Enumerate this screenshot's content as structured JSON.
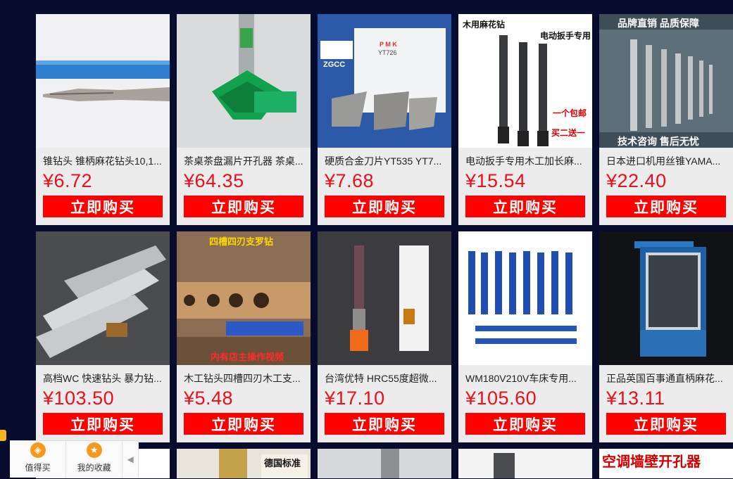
{
  "buy_label": "立即购买",
  "products": [
    {
      "title": "锥钻头 锥柄麻花钻头10,1...",
      "price": "¥6.72"
    },
    {
      "title": "茶桌茶盘漏片开孔器 茶桌...",
      "price": "¥64.35"
    },
    {
      "title": "硬质合金刀片YT535 YT7...",
      "price": "¥7.68"
    },
    {
      "title": "电动扳手专用木工加长麻...",
      "price": "¥15.54"
    },
    {
      "title": "日本进口机用丝锥YAMA...",
      "price": "¥22.40"
    },
    {
      "title": "高档WC 快速钻头 暴力钻...",
      "price": "¥103.50"
    },
    {
      "title": "木工钻头四槽四刃木工支...",
      "price": "¥5.48"
    },
    {
      "title": "台湾优特 HRC55度超微...",
      "price": "¥17.10"
    },
    {
      "title": "WM180V210V车床专用...",
      "price": "¥105.60"
    },
    {
      "title": "正品英国百事通直柄麻花...",
      "price": "¥13.11"
    }
  ],
  "image_text": {
    "p2_brand": "ZGCC",
    "p2_label_line1": "P  M  K",
    "p2_label_line2": "YT726",
    "p3_top_left": "木用麻花钻",
    "p3_top_right": "电动扳手专用",
    "p3_promo1": "一个包邮",
    "p3_promo2": "买二送一",
    "p4_top": "品牌直销 品质保障",
    "p4_bottom": "技术咨询 售后无忧",
    "p6_top": "四槽四刃支罗钻",
    "p6_bottom": "内有店主操作视频",
    "r3_p1_text": "德国标准",
    "r3_p4_text": "空调墙壁开孔器"
  },
  "dock": {
    "item1": "值得买",
    "item2": "我的收藏",
    "collapse": "◀"
  }
}
